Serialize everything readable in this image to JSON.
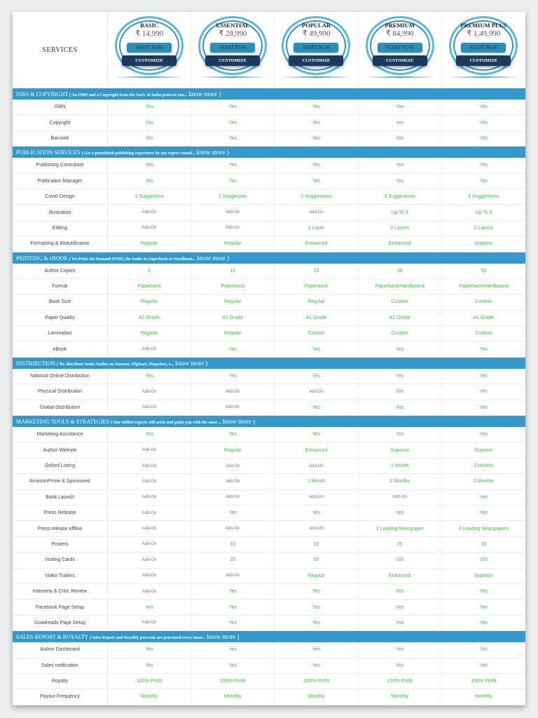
{
  "services_label": "SERVICES",
  "plans": [
    {
      "name": "BASIC",
      "price": "₹ 14,990",
      "start": "START NOW",
      "customize": "CUSTOMIZE"
    },
    {
      "name": "ESSENTIAL",
      "price": "₹ 28,990",
      "start": "START NOW",
      "customize": "CUSTOMIZE"
    },
    {
      "name": "POPULAR",
      "price": "₹ 49,990",
      "start": "START NOW",
      "customize": "CUSTOMIZE"
    },
    {
      "name": "PREMIUM",
      "price": "₹ 84,990",
      "start": "START NOW",
      "customize": "CUSTOMIZE"
    },
    {
      "name": "PREMIUM PLUS",
      "price": "₹ 1,49,990",
      "start": "START NOW",
      "customize": "CUSTOMIZE"
    }
  ],
  "sections": [
    {
      "title": "ISBN & COPYRIGHT",
      "desc": "( An ISBN and a Copyright from the Govt. of India protects you...",
      "more": "know more )",
      "rows": [
        {
          "label": "ISBN",
          "values": [
            "Yes",
            "Yes",
            "Yes",
            "Yes",
            "Yes"
          ]
        },
        {
          "label": "Copyright",
          "values": [
            "Yes",
            "Yes",
            "Yes",
            "Yes",
            "Yes"
          ]
        },
        {
          "label": "Barcode",
          "values": [
            "Yes",
            "Yes",
            "Yes",
            "Yes",
            "Yes"
          ]
        }
      ]
    },
    {
      "title": "PUBLICATION SERVICES",
      "desc": "( Get a prioritized publishing experience by our expert consul...",
      "more": "know more )",
      "rows": [
        {
          "label": "Publishing Consultant",
          "values": [
            "Yes",
            "Yes",
            "Yes",
            "Yes",
            "Yes"
          ]
        },
        {
          "label": "Publication Manager",
          "values": [
            "Yes",
            "Yes",
            "Yes",
            "Yes",
            "Yes"
          ]
        },
        {
          "label": "Cover Design",
          "values": [
            "1 Suggestion",
            "1 Suggestion",
            "2 Suggestions",
            "3 Suggestions",
            "5 Suggestions"
          ]
        },
        {
          "label": "Illustration",
          "values": [
            "Add-On",
            "Add-On",
            "Add-On",
            "Up To 3",
            "Up To 5"
          ]
        },
        {
          "label": "Editing",
          "values": [
            "Add-On",
            "Add-On",
            "1 Layer",
            "2 Layers",
            "2 Layers"
          ]
        },
        {
          "label": "Formatting & Beautification",
          "values": [
            "Regular",
            "Regular",
            "Enhanced",
            "Enhanced",
            "Superior"
          ]
        }
      ]
    },
    {
      "title": "PRINTING & eBOOK",
      "desc": "( We Print On Demand (POD), the books in Paperback or Hardboun...",
      "more": "know more )",
      "rows": [
        {
          "label": "Author Copies",
          "values": [
            "5",
            "10",
            "20",
            "30",
            "50"
          ]
        },
        {
          "label": "Format",
          "values": [
            "Paperback",
            "Paperback",
            "Paperback",
            "Paperback/Hardbound",
            "Paperback/Hardbound"
          ]
        },
        {
          "label": "Book Size",
          "values": [
            "Regular",
            "Regular",
            "Regular",
            "Custom",
            "Custom"
          ]
        },
        {
          "label": "Paper Quality",
          "values": [
            "A1 Grade",
            "A1 Grade",
            "A1 Grade",
            "A1 Grade",
            "A1 Grade"
          ]
        },
        {
          "label": "Lamination",
          "values": [
            "Regular",
            "Regular",
            "Custom",
            "Custom",
            "Custom"
          ]
        },
        {
          "label": "eBook",
          "values": [
            "Add-On",
            "Yes",
            "Yes",
            "Yes",
            "Yes"
          ]
        }
      ]
    },
    {
      "title": "DISTRIBUTION",
      "desc": "( We distribute books Online on Amazon, Flipkart, Shopclues, e...",
      "more": "know more )",
      "rows": [
        {
          "label": "National Online Distribution",
          "values": [
            "Yes",
            "Yes",
            "Yes",
            "Yes",
            "Yes"
          ]
        },
        {
          "label": "Physical Distribution",
          "values": [
            "Add-On",
            "Add-On",
            "Add-On",
            "Yes",
            "Yes"
          ]
        },
        {
          "label": "Global Distribution",
          "values": [
            "Add-On",
            "Add-On",
            "Yes",
            "Yes",
            "Yes"
          ]
        }
      ]
    },
    {
      "title": "MARKETING TOOLS & STRATEGIES",
      "desc": "( Our skilled experts will assist and guide you with the most ...",
      "more": "know more )",
      "rows": [
        {
          "label": "Marketing Assistance",
          "values": [
            "Yes",
            "Yes",
            "Yes",
            "Yes",
            "Yes"
          ]
        },
        {
          "label": "Author Website",
          "values": [
            "Add-On",
            "Regular",
            "Enhanced",
            "Superior",
            "Superior"
          ]
        },
        {
          "label": "Oxford Listing",
          "values": [
            "Add-On",
            "Add-On",
            "Add-On",
            "1 Month",
            "3 Months"
          ]
        },
        {
          "label": "AmazonPrime & Sponsored",
          "values": [
            "Add-On",
            "Add-On",
            "1 Month",
            "2 Months",
            "3 Months"
          ]
        },
        {
          "label": "Book Launch",
          "values": [
            "Add-On",
            "Add-On",
            "Add-On",
            "Add-On",
            "Yes"
          ]
        },
        {
          "label": "Press Release",
          "values": [
            "Add-On",
            "Yes",
            "Yes",
            "Yes",
            "Yes"
          ]
        },
        {
          "label": "Press release offline",
          "values": [
            "Add-On",
            "Add-On",
            "Add-On",
            "1 Leading Newspaper",
            "3 Leading Newspapers"
          ]
        },
        {
          "label": "Posters",
          "values": [
            "Add-On",
            "10",
            "15",
            "25",
            "30"
          ]
        },
        {
          "label": "Visiting Cards",
          "values": [
            "Add-On",
            "25",
            "50",
            "100",
            "100"
          ]
        },
        {
          "label": "Video Trailers",
          "values": [
            "Add-On",
            "Add-On",
            "Regular",
            "Enhanced",
            "Superior"
          ]
        },
        {
          "label": "Interview & Critic Review",
          "values": [
            "Add-On",
            "Yes",
            "Yes",
            "Yes",
            "Yes"
          ]
        },
        {
          "label": "Facebook Page Setup",
          "values": [
            "Yes",
            "Yes",
            "Yes",
            "Yes",
            "Yes"
          ]
        },
        {
          "label": "Goodreads Page Setup",
          "values": [
            "Add-On",
            "Yes",
            "Yes",
            "Yes",
            "Yes"
          ]
        }
      ]
    },
    {
      "title": "SALES REPORT & ROYALTY",
      "desc": "( Sales Report and Royality proceeds are processed every  mont...",
      "more": "know more )",
      "rows": [
        {
          "label": "Author Dashboard",
          "values": [
            "Yes",
            "Yes",
            "Yes",
            "Yes",
            "Yes"
          ]
        },
        {
          "label": "Sales notification",
          "values": [
            "Yes",
            "Yes",
            "Yes",
            "Yes",
            "Yes"
          ]
        },
        {
          "label": "Royalty",
          "values": [
            "100% Profit",
            "100% Profit",
            "100% Profit",
            "100% Profit",
            "100% Profit"
          ]
        },
        {
          "label": "Payout Frequency",
          "values": [
            "Monthly",
            "Monthly",
            "Monthly",
            "Monthly",
            "Monthly"
          ]
        }
      ]
    }
  ],
  "colors": {
    "section_bar": "#3399cc",
    "value_green": "#3cc43c",
    "customize_bg": "#1b3a5f",
    "start_bg": "#2a8fb8"
  }
}
